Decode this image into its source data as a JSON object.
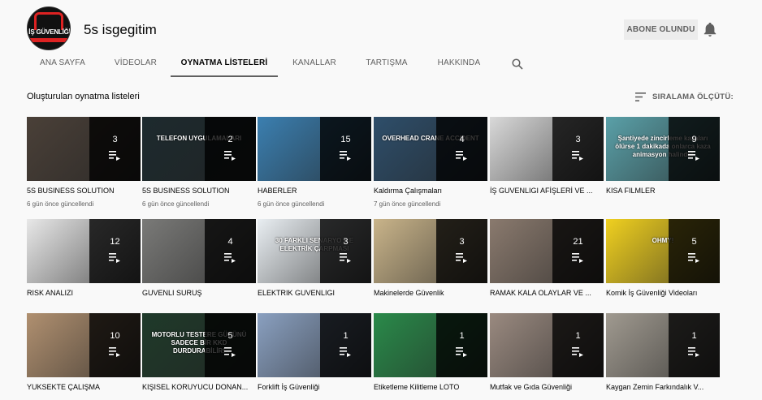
{
  "channel": {
    "name": "5s isgegitim",
    "avatar_text": "İŞ GÜVENLİĞİ",
    "subscribe_label": "ABONE OLUNDU"
  },
  "tabs": [
    {
      "label": "ANA SAYFA",
      "active": false
    },
    {
      "label": "VİDEOLAR",
      "active": false
    },
    {
      "label": "OYNATMA LİSTELERİ",
      "active": true
    },
    {
      "label": "KANALLAR",
      "active": false
    },
    {
      "label": "TARTIŞMA",
      "active": false
    },
    {
      "label": "HAKKINDA",
      "active": false
    }
  ],
  "section": {
    "title": "Oluşturulan oynatma listeleri",
    "sort_label": "SIRALAMA ÖLÇÜTÜ:"
  },
  "playlists": [
    {
      "title": "5S BUSINESS SOLUTION",
      "count": "3",
      "meta": "6 gün önce güncellendi",
      "thumb_text": "",
      "bg": "#4a4038"
    },
    {
      "title": "5S BUSINESS SOLUTION",
      "count": "2",
      "meta": "6 gün önce güncellendi",
      "thumb_text": "TELEFON UYGULAMALARI",
      "bg": "#1d2a2e"
    },
    {
      "title": "HABERLER",
      "count": "15",
      "meta": "6 gün önce güncellendi",
      "thumb_text": "",
      "bg": "#3b7fb0"
    },
    {
      "title": "Kaldırma Çalışmaları",
      "count": "4",
      "meta": "7 gün önce güncellendi",
      "thumb_text": "OVERHEAD CRANE ACCIDENT",
      "bg": "#2e4e6a"
    },
    {
      "title": "İŞ GUVENLIGI AFİŞLERİ VE ...",
      "count": "3",
      "meta": "",
      "thumb_text": "",
      "bg": "#d9d9d9"
    },
    {
      "title": "KISA FILMLER",
      "count": "9",
      "meta": "",
      "thumb_text": "Şantiyede zincirleme kazaları ölürse 1 dakikada onlarca kaza animasyon halinde!",
      "bg": "#5aa0a8"
    },
    {
      "title": "RISK ANALIZI",
      "count": "12",
      "meta": "",
      "thumb_text": "",
      "bg": "#e8e8e8"
    },
    {
      "title": "GUVENLI SURUŞ",
      "count": "4",
      "meta": "",
      "thumb_text": "",
      "bg": "#7a7a78"
    },
    {
      "title": "ELEKTRIK GUVENLIGI",
      "count": "3",
      "meta": "",
      "thumb_text": "30 FARKLI SENARYO İLE ELEKTRİK ÇARPMASI",
      "bg": "#e9eef2"
    },
    {
      "title": "Makinelerde Güvenlik",
      "count": "3",
      "meta": "",
      "thumb_text": "",
      "bg": "#c9b48a"
    },
    {
      "title": "RAMAK KALA OLAYLAR VE ...",
      "count": "21",
      "meta": "",
      "thumb_text": "",
      "bg": "#8a7a6e"
    },
    {
      "title": "Komik İş Güvenliği Videoları",
      "count": "5",
      "meta": "",
      "thumb_text": "OHMY!",
      "bg": "#f0d020"
    },
    {
      "title": "YUKSEKTE ÇALIŞMA",
      "count": "10",
      "meta": "",
      "thumb_text": "",
      "bg": "#b09070"
    },
    {
      "title": "KIŞISEL KORUYUCU DONAN...",
      "count": "5",
      "meta": "",
      "thumb_text": "MOTORLU TESTERE GÜCÜNÜ SADECE BİR KKD DURDURABİLİR!",
      "bg": "#1f3a2a"
    },
    {
      "title": "Forklift İş Güvenliği",
      "count": "1",
      "meta": "",
      "thumb_text": "",
      "bg": "#8aa0c0"
    },
    {
      "title": "Etiketleme Kilitleme LOTO",
      "count": "1",
      "meta": "",
      "thumb_text": "",
      "bg": "#2a8a4a"
    },
    {
      "title": "Mutfak ve Gıda Güvenliği",
      "count": "1",
      "meta": "",
      "thumb_text": "",
      "bg": "#9a8a80"
    },
    {
      "title": "Kaygan Zemin Farkındalık V...",
      "count": "1",
      "meta": "",
      "thumb_text": "",
      "bg": "#a09a90"
    }
  ]
}
